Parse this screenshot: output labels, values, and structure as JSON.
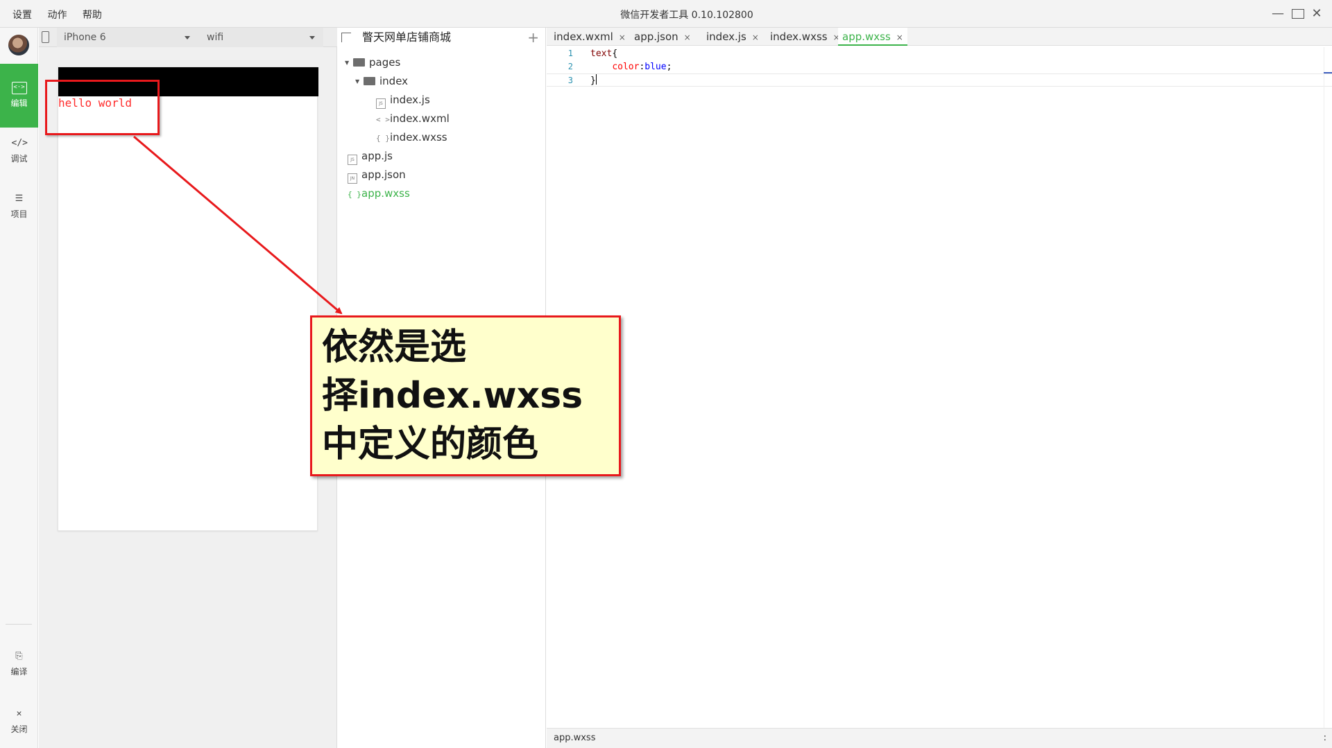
{
  "titlebar": {
    "menu": [
      "设置",
      "动作",
      "帮助"
    ],
    "title": "微信开发者工具 0.10.102800",
    "minimize": "—",
    "close": "✕"
  },
  "sidebar": {
    "items": [
      {
        "label": "编辑",
        "icon": "<·>",
        "active": true
      },
      {
        "label": "调试",
        "icon": "</>",
        "active": false
      },
      {
        "label": "项目",
        "icon": "☰",
        "active": false
      },
      {
        "label": "编译",
        "icon": "⎘",
        "active": false
      },
      {
        "label": "关闭",
        "icon": "✕",
        "active": false
      }
    ]
  },
  "simulator": {
    "device": "iPhone 6",
    "network": "wifi",
    "page_text": "hello world"
  },
  "tree": {
    "project_name": "瞥天网单店铺商城",
    "add": "+",
    "items": [
      {
        "name": "pages",
        "type": "folder"
      },
      {
        "name": "index",
        "type": "folder"
      },
      {
        "name": "index.js",
        "type": "js",
        "badge": "JS"
      },
      {
        "name": "index.wxml",
        "type": "wxml",
        "badge": "< >"
      },
      {
        "name": "index.wxss",
        "type": "wxss",
        "badge": "{ }"
      },
      {
        "name": "app.js",
        "type": "js",
        "badge": "JS"
      },
      {
        "name": "app.json",
        "type": "json",
        "badge": "JN"
      },
      {
        "name": "app.wxss",
        "type": "wxss",
        "badge": "{ }",
        "active": true
      }
    ]
  },
  "editor": {
    "tabs": [
      {
        "label": "index.wxml",
        "active": false
      },
      {
        "label": "app.json",
        "active": false
      },
      {
        "label": "index.js",
        "active": false
      },
      {
        "label": "index.wxss",
        "active": false
      },
      {
        "label": "app.wxss",
        "active": true
      }
    ],
    "tab_close": "×",
    "lines": [
      {
        "n": "1",
        "selector": "text",
        "brace": "{"
      },
      {
        "n": "2",
        "prop": "color",
        "colon": ":",
        "value": "blue",
        "semi": ";"
      },
      {
        "n": "3",
        "close": "}"
      }
    ],
    "status_file": "app.wxss",
    "status_right": ":"
  },
  "annotation": {
    "callout_lines": [
      "依然是选",
      "择index.wxss",
      "中定义的颜色"
    ]
  },
  "colors": {
    "accent_green": "#3cb34a",
    "annotation_red": "#e8191c",
    "callout_bg": "#ffffcc",
    "hello_red": "#ff2a2a"
  }
}
